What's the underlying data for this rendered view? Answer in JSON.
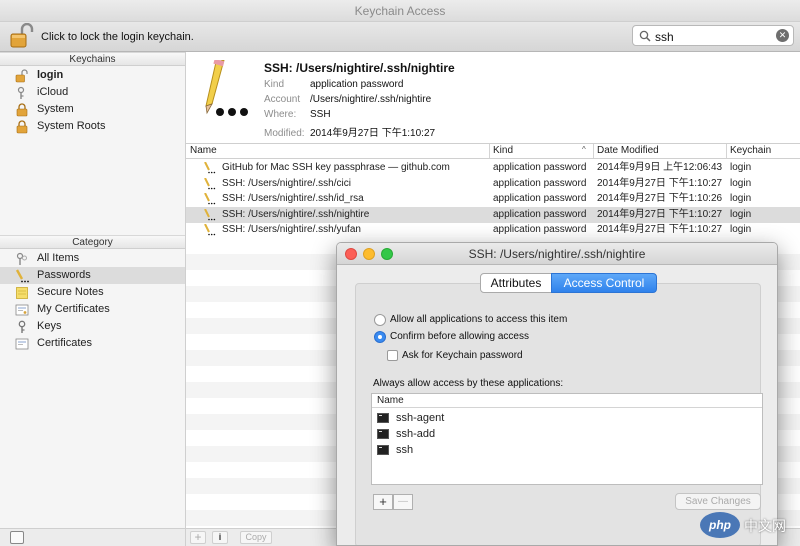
{
  "window": {
    "title": "Keychain Access"
  },
  "toolbar": {
    "lock_label": "Click to lock the login keychain.",
    "search_value": "ssh",
    "clear_glyph": "✕"
  },
  "sidebar": {
    "keychains_header": "Keychains",
    "keychains": [
      {
        "label": "login",
        "icon": "unlocked-padlock-icon",
        "bold": true
      },
      {
        "label": "iCloud",
        "icon": "keychain-icon"
      },
      {
        "label": "System",
        "icon": "padlock-icon"
      },
      {
        "label": "System Roots",
        "icon": "padlock-icon"
      }
    ],
    "category_header": "Category",
    "categories": [
      {
        "label": "All Items",
        "icon": "keys-icon"
      },
      {
        "label": "Passwords",
        "icon": "pencil-dots-icon",
        "selected": true
      },
      {
        "label": "Secure Notes",
        "icon": "note-icon"
      },
      {
        "label": "My Certificates",
        "icon": "certificate-icon"
      },
      {
        "label": "Keys",
        "icon": "key-icon"
      },
      {
        "label": "Certificates",
        "icon": "certificate-icon"
      }
    ]
  },
  "detail": {
    "title": "SSH: /Users/nightire/.ssh/nightire",
    "kind_label": "Kind",
    "kind": "application password",
    "account_label": "Account",
    "account": "/Users/nightire/.ssh/nightire",
    "where_label": "Where:",
    "where": "SSH",
    "modified_label": "Modified:",
    "modified": "2014年9月27日 下午1:10:27"
  },
  "table": {
    "headers": [
      "Name",
      "Kind",
      "Date Modified",
      "Keychain"
    ],
    "rows": [
      {
        "name": "GitHub for Mac SSH key passphrase — github.com",
        "kind": "application password",
        "date": "2014年9月9日 上午12:06:43",
        "keychain": "login"
      },
      {
        "name": "SSH: /Users/nightire/.ssh/cici",
        "kind": "application password",
        "date": "2014年9月27日 下午1:10:27",
        "keychain": "login"
      },
      {
        "name": "SSH: /Users/nightire/.ssh/id_rsa",
        "kind": "application password",
        "date": "2014年9月27日 下午1:10:26",
        "keychain": "login"
      },
      {
        "name": "SSH: /Users/nightire/.ssh/nightire",
        "kind": "application password",
        "date": "2014年9月27日 下午1:10:27",
        "keychain": "login",
        "selected": true
      },
      {
        "name": "SSH: /Users/nightire/.ssh/yufan",
        "kind": "application password",
        "date": "2014年9月27日 下午1:10:27",
        "keychain": "login"
      }
    ]
  },
  "bottom_bar": {
    "add": "+",
    "info": "i",
    "copy": "Copy"
  },
  "popup": {
    "title": "SSH: /Users/nightire/.ssh/nightire",
    "tabs": [
      "Attributes",
      "Access Control"
    ],
    "active_tab": "Access Control",
    "allow_all": "Allow all applications to access this item",
    "confirm": "Confirm before allowing access",
    "ask_password": "Ask for Keychain password",
    "always_allow_label": "Always allow access by these applications:",
    "apps_header": "Name",
    "apps": [
      "ssh-agent",
      "ssh-add",
      "ssh"
    ],
    "add": "+",
    "remove": "—",
    "save": "Save Changes"
  },
  "watermark": {
    "logo": "php",
    "text": "中文网"
  },
  "colors": {
    "accent": "#3a8bf0",
    "selection": "#dcdcdc",
    "close": "#fc5f57",
    "minimize": "#fdbc2e",
    "zoom": "#33c748"
  }
}
